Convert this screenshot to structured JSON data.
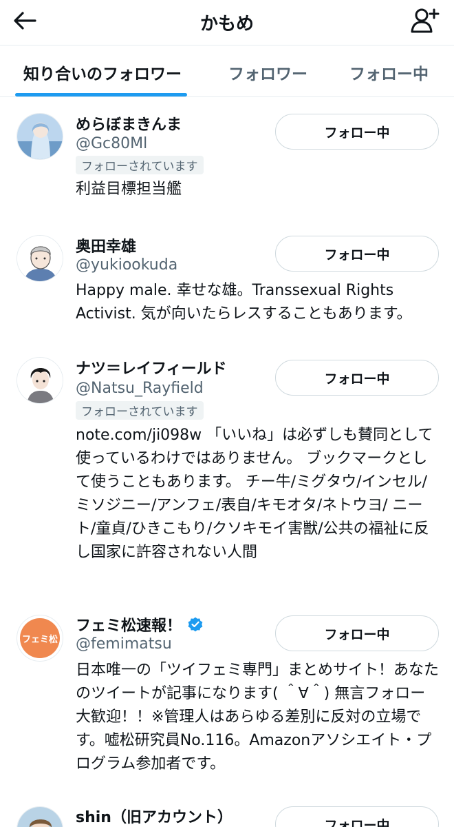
{
  "header": {
    "title": "かもめ"
  },
  "tabs": [
    {
      "label": "知り合いのフォロワー"
    },
    {
      "label": "フォロワー"
    },
    {
      "label": "フォロー中"
    }
  ],
  "users": [
    {
      "name": "めらぼまきんま",
      "handle": "@Gc80Ml",
      "follows_you": "フォローされています",
      "bio": "利益目標担当艦",
      "button": "フォロー中"
    },
    {
      "name": "奥田幸雄",
      "handle": "@yukiookuda",
      "bio": "Happy male. 幸せな雄。Transsexual Rights Activist. 気が向いたらレスすることもあります。",
      "button": "フォロー中"
    },
    {
      "name": "ナツ＝レイフィールド",
      "handle": "@Natsu_Rayfield",
      "follows_you": "フォローされています",
      "bio": "note.com/ji098w 「いいね」は必ずしも賛同として使っているわけではありません。 ブックマークとして使うこともあります。 チー牛/ミグタウ/インセル/ミソジニー/アンフェ/表自/キモオタ/ネトウヨ/ ニート/童貞/ひきこもり/クソキモイ害獣/公共の福祉に反し国家に許容されない人間",
      "button": "フォロー中"
    },
    {
      "name": "フェミ松速報！",
      "handle": "@femimatsu",
      "verified": true,
      "avatar_text": "フェミ松",
      "bio": "日本唯一の「ツイフェミ専門」まとめサイト！あなたのツイートが記事になります( ＾∀＾) 無言フォロー大歓迎！！※管理人はあらゆる差別に反対の立場です。嘘松研究員No.116。Amazonアソシエイト・プログラム参加者です。",
      "button": "フォロー中"
    },
    {
      "name": "shin（旧アカウント）",
      "button": "フォロー中"
    }
  ],
  "colors": {
    "accent": "#1d9bf0",
    "text": "#0f1419",
    "secondary": "#536471",
    "border": "#cfd9de",
    "avatar_brand": "#f0884f"
  },
  "icons": [
    "back-arrow-icon",
    "add-user-icon",
    "verified-badge-icon"
  ]
}
